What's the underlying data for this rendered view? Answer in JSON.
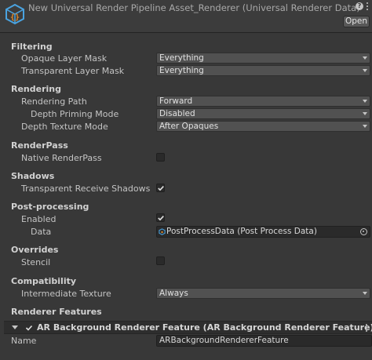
{
  "header": {
    "title": "New Universal Render Pipeline Asset_Renderer (Universal Renderer Data)",
    "help_icon": "help-icon",
    "menu_icon": "kebab-menu-icon",
    "open_label": "Open"
  },
  "filtering": {
    "title": "Filtering",
    "opaque_layer_mask": {
      "label": "Opaque Layer Mask",
      "value": "Everything"
    },
    "transparent_layer_mask": {
      "label": "Transparent Layer Mask",
      "value": "Everything"
    }
  },
  "rendering": {
    "title": "Rendering",
    "rendering_path": {
      "label": "Rendering Path",
      "value": "Forward"
    },
    "depth_priming_mode": {
      "label": "Depth Priming Mode",
      "value": "Disabled"
    },
    "depth_texture_mode": {
      "label": "Depth Texture Mode",
      "value": "After Opaques"
    }
  },
  "renderpass": {
    "title": "RenderPass",
    "native_renderpass": {
      "label": "Native RenderPass",
      "checked": false
    }
  },
  "shadows": {
    "title": "Shadows",
    "transparent_receive_shadows": {
      "label": "Transparent Receive Shadows",
      "checked": true
    }
  },
  "post_processing": {
    "title": "Post-processing",
    "enabled": {
      "label": "Enabled",
      "checked": true
    },
    "data": {
      "label": "Data",
      "value": "PostProcessData (Post Process Data)"
    }
  },
  "overrides": {
    "title": "Overrides",
    "stencil": {
      "label": "Stencil",
      "checked": false
    }
  },
  "compatibility": {
    "title": "Compatibility",
    "intermediate_texture": {
      "label": "Intermediate Texture",
      "value": "Always"
    }
  },
  "renderer_features": {
    "title": "Renderer Features",
    "feature": {
      "title": "AR Background Renderer Feature (AR Background Renderer Feature)",
      "enabled": true,
      "name_label": "Name",
      "name_value": "ARBackgroundRendererFeature"
    }
  },
  "colors": {
    "background": "#383838",
    "field": "#515151",
    "checkbox_bg": "#2a2a2a",
    "text": "#c4c4c4",
    "icon_blue": "#4aa3e0",
    "icon_orange": "#e08a2a"
  }
}
